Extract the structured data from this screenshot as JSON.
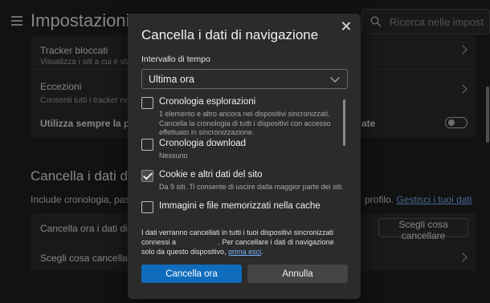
{
  "colors": {
    "page_bg": "#202020",
    "card_bg": "#2b2b2b",
    "accent": "#0f6cbd",
    "link": "#7ab4ff"
  },
  "header": {
    "title": "Impostazioni",
    "menu_icon": "hamburger-menu-icon",
    "search_icon": "search-icon",
    "search_placeholder": "Ricerca nelle impostazi..."
  },
  "tracking_card": {
    "rows": [
      {
        "title": "Tracker bloccati",
        "subtitle": "Visualizza i siti a cui è stato i"
      },
      {
        "title": "Eccezioni",
        "subtitle": "Consenti tutti i tracker nei sit"
      },
      {
        "title": "Utilizza sempre la preve",
        "suffix": "ate",
        "toggle_on": false
      }
    ]
  },
  "clear_section": {
    "title": "Cancella i dati di n",
    "desc": "Include cronologia, passwo",
    "desc_tail": "profilo.",
    "link": "Gestisci i tuoi dati",
    "rows": [
      {
        "title": "Cancella ora i dati di nav",
        "button": "Scegli cosa cancellare"
      },
      {
        "title": "Scegli cosa cancellare o"
      }
    ]
  },
  "dialog": {
    "title": "Cancella i dati di navigazione",
    "close_icon": "close-icon",
    "range_label": "Intervallo di tempo",
    "range_value": "Ultima ora",
    "options": [
      {
        "title": "Cronologia esplorazioni",
        "desc": "1 elemento e altro ancora nei dispositivi sincronizzati. Cancella la cronologia di tutti i dispositivi con accesso effettuato in sincronizzazione.",
        "checked": false
      },
      {
        "title": "Cronologia download",
        "desc": "Nessuno",
        "checked": false
      },
      {
        "title": "Cookie e altri dati del sito",
        "desc": "Da 9 siti. Ti consente di uscire dalla maggior parte dei siti.",
        "checked": true
      },
      {
        "title": "Immagini e file memorizzati nella cache",
        "desc": "",
        "checked": false
      }
    ],
    "note_part1": "I dati verranno cancellati in tutti i tuoi dispositivi sincronizzati connessi a",
    "note_part2": ". Per cancellare i dati di navigazione solo da questo dispositivo,",
    "note_link": "prima esci",
    "note_end": ".",
    "primary_button": "Cancella ora",
    "secondary_button": "Annulla"
  }
}
